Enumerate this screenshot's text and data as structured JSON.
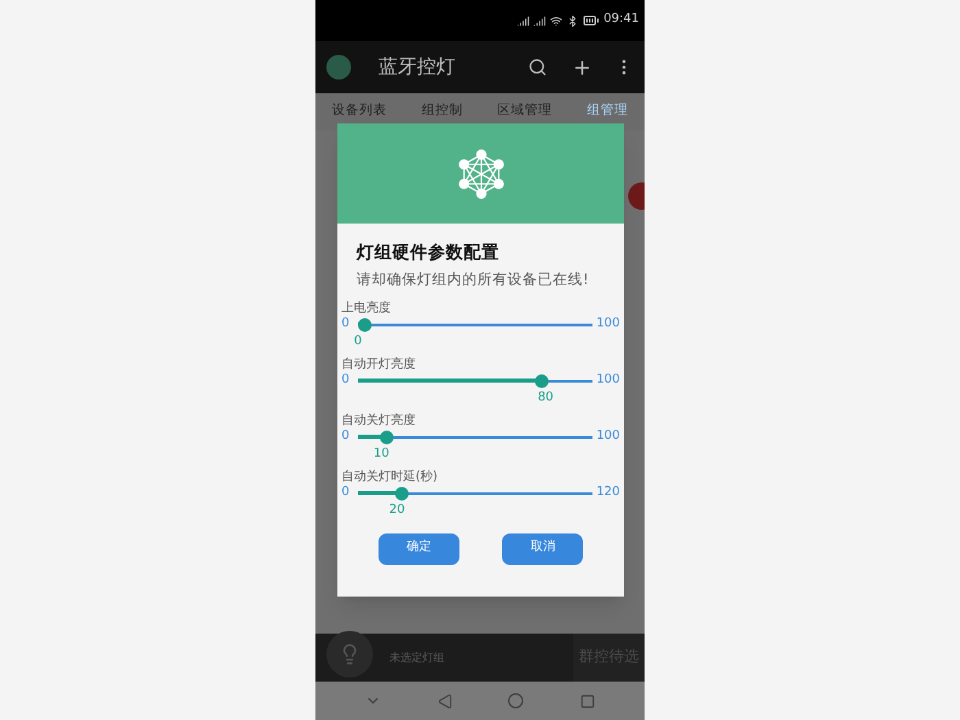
{
  "status_bar": {
    "time": "09:41"
  },
  "app_bar": {
    "title": "蓝牙控灯"
  },
  "tabs": [
    {
      "label": "设备列表",
      "selected": false
    },
    {
      "label": "组控制",
      "selected": false
    },
    {
      "label": "区域管理",
      "selected": false
    },
    {
      "label": "组管理",
      "selected": true
    }
  ],
  "dialog": {
    "title": "灯组硬件参数配置",
    "subtitle": "请却确保灯组内的所有设备已在线!",
    "sliders": [
      {
        "label": "上电亮度",
        "min": "0",
        "max": "100",
        "value": "0",
        "level": 0
      },
      {
        "label": "自动开灯亮度",
        "min": "0",
        "max": "100",
        "value": "80",
        "level": 0.8
      },
      {
        "label": "自动关灯亮度",
        "min": "0",
        "max": "100",
        "value": "10",
        "level": 0.1
      },
      {
        "label": "自动关灯时延(秒)",
        "min": "0",
        "max": "120",
        "value": "20",
        "level": 0.1667
      }
    ],
    "buttons": [
      "确定",
      "取消"
    ]
  },
  "bottom_bar": {
    "label": "未选定灯组",
    "action": "群控待选"
  }
}
